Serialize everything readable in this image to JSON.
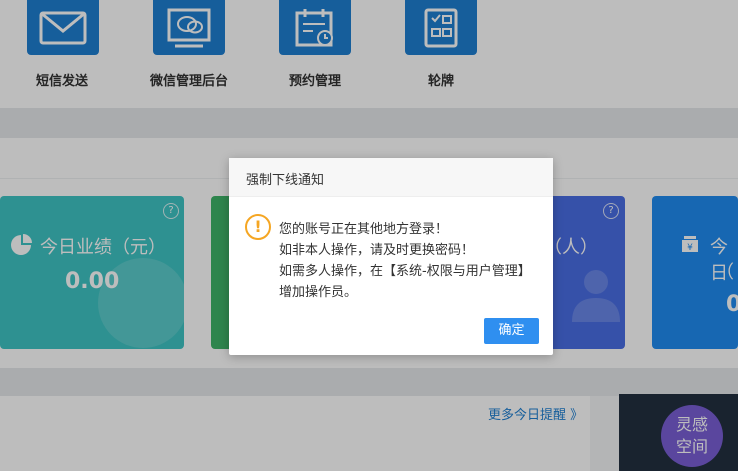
{
  "apps": [
    {
      "label": "短信发送",
      "icon": "mail-icon"
    },
    {
      "label": "微信管理后台",
      "icon": "wechat-icon"
    },
    {
      "label": "预约管理",
      "icon": "calendar-icon"
    },
    {
      "label": "轮牌",
      "icon": "checklist-icon"
    }
  ],
  "cards": {
    "today_performance": {
      "title": "今日业绩（元）",
      "value": "0.00",
      "icon": "pie-chart-icon"
    },
    "people": {
      "title": "（人）",
      "icon": "users-icon"
    },
    "today_right": {
      "title": "今日",
      "sub": "（",
      "value": "0",
      "icon": "money-icon"
    }
  },
  "reminders": {
    "more_link": "更多今日提醒 》"
  },
  "badge": {
    "line1": "灵感",
    "line2": "空间"
  },
  "dialog": {
    "title": "强制下线通知",
    "lines": [
      "您的账号正在其他地方登录！",
      "如非本人操作，请及时更换密码！",
      "如需多人操作，在【系统-权限与用户管理】",
      "增加操作员。"
    ],
    "ok_label": "确定"
  },
  "colors": {
    "primary": "#1e7fd2",
    "teal_card": "#3fc4c4",
    "green_card": "#3fb469",
    "indigo_card": "#4a6ee5",
    "blue_card": "#1f8cf0",
    "warning": "#f5a623",
    "button": "#2f8ff0"
  }
}
